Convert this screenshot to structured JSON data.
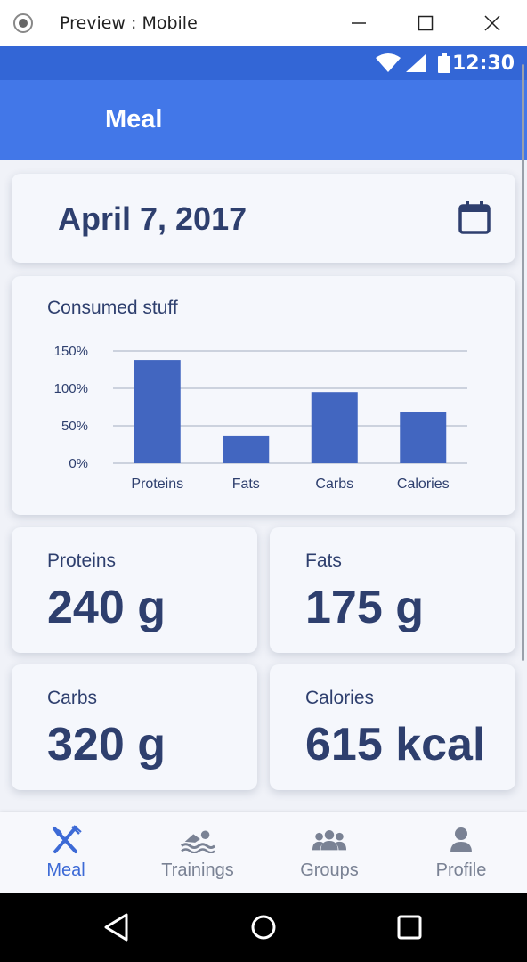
{
  "window": {
    "title": "Preview : Mobile"
  },
  "status_bar": {
    "time": "12:30"
  },
  "app_bar": {
    "title": "Meal"
  },
  "date_card": {
    "date": "April 7, 2017",
    "calendar_icon": "calendar-icon"
  },
  "chart_data": {
    "type": "bar",
    "title": "Consumed stuff",
    "categories": [
      "Proteins",
      "Fats",
      "Carbs",
      "Calories"
    ],
    "values": [
      138,
      37,
      95,
      68
    ],
    "y_ticks": [
      "150%",
      "100%",
      "50%",
      "0%"
    ],
    "ylim": [
      0,
      150
    ],
    "grid": true,
    "color": "#4266c0"
  },
  "stats": [
    {
      "label": "Proteins",
      "value": "240 g"
    },
    {
      "label": "Fats",
      "value": "175 g"
    },
    {
      "label": "Carbs",
      "value": "320 g"
    },
    {
      "label": "Calories",
      "value": "615 kcal"
    }
  ],
  "bottom_nav": [
    {
      "label": "Meal",
      "icon": "fork-knife-icon",
      "active": true
    },
    {
      "label": "Trainings",
      "icon": "swimmer-icon",
      "active": false
    },
    {
      "label": "Groups",
      "icon": "group-icon",
      "active": false
    },
    {
      "label": "Profile",
      "icon": "person-icon",
      "active": false
    }
  ],
  "colors": {
    "primary": "#4277e8",
    "status_bar": "#3366d6",
    "text": "#2e3f6e",
    "active_nav": "#3d6ad6"
  }
}
